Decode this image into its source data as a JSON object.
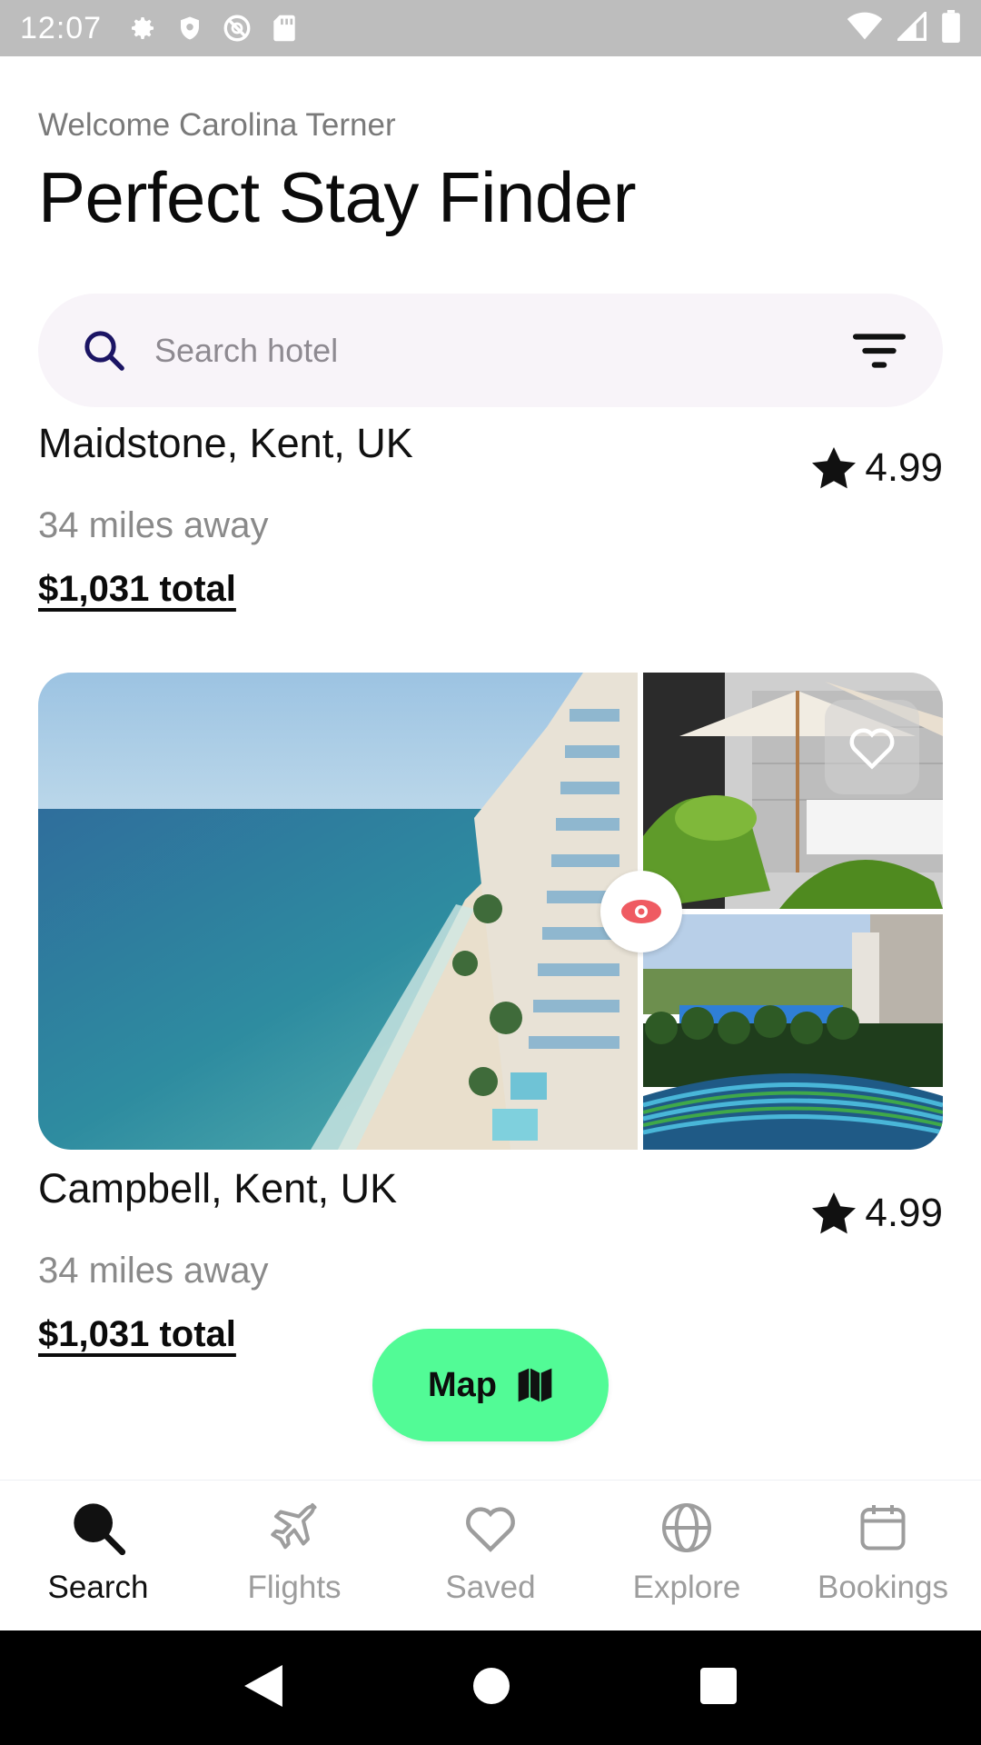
{
  "status_bar": {
    "time": "12:07",
    "icons_left": [
      "gear-icon",
      "shield-icon",
      "no-sync-icon",
      "sd-card-icon"
    ],
    "icons_right": [
      "wifi-icon",
      "signal-icon",
      "battery-icon"
    ]
  },
  "header": {
    "welcome": "Welcome Carolina Terner",
    "title": "Perfect Stay Finder"
  },
  "search": {
    "placeholder": "Search hotel",
    "value": ""
  },
  "listings": [
    {
      "location": "Maidstone, Kent, UK",
      "rating": "4.99",
      "distance": "34 miles away",
      "price": "$1,031 total"
    },
    {
      "location": "Campbell, Kent, UK",
      "rating": "4.99",
      "distance": "34 miles away",
      "price": "$1,031 total",
      "photos": [
        "beach-hotel-photo",
        "patio-umbrella-photo",
        "pool-hammock-photo"
      ]
    }
  ],
  "map_button": {
    "label": "Map"
  },
  "bottom_nav": {
    "items": [
      {
        "label": "Search",
        "icon": "search-icon",
        "active": true
      },
      {
        "label": "Flights",
        "icon": "airplane-icon",
        "active": false
      },
      {
        "label": "Saved",
        "icon": "heart-icon",
        "active": false
      },
      {
        "label": "Explore",
        "icon": "globe-icon",
        "active": false
      },
      {
        "label": "Bookings",
        "icon": "calendar-icon",
        "active": false
      }
    ]
  },
  "colors": {
    "accent_green": "#52fb96",
    "eye_red": "#ef5b62",
    "search_bg": "#f8f4f9"
  }
}
